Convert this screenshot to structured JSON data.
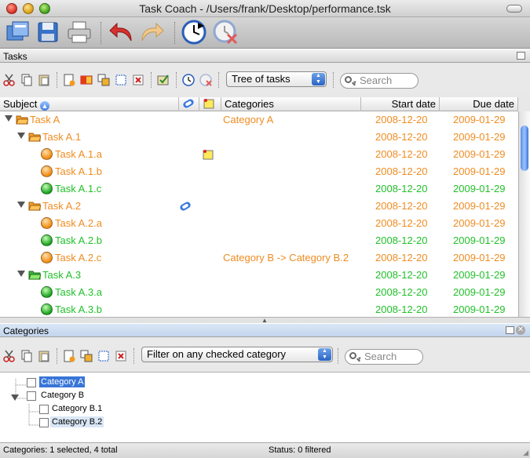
{
  "window": {
    "title": "Task Coach - /Users/frank/Desktop/performance.tsk"
  },
  "main_toolbar": {
    "icons": [
      "open-icon",
      "save-icon",
      "print-icon",
      "undo-icon",
      "redo-icon",
      "start-tracking-icon",
      "stop-tracking-icon"
    ]
  },
  "tasks_panel": {
    "title": "Tasks",
    "view_choice": "Tree of tasks",
    "search_placeholder": "Search",
    "columns": {
      "subject": "Subject",
      "categories": "Categories",
      "start_date": "Start date",
      "due_date": "Due date"
    },
    "rows": [
      {
        "subject": "Task A",
        "categories": "Category A",
        "start": "2008-12-20",
        "due": "2009-01-29",
        "color": "#ef8c22"
      },
      {
        "subject": "Task A.1",
        "categories": "",
        "start": "2008-12-20",
        "due": "2009-01-29",
        "color": "#ef8c22"
      },
      {
        "subject": "Task A.1.a",
        "categories": "",
        "start": "2008-12-20",
        "due": "2009-01-29",
        "color": "#ef8c22"
      },
      {
        "subject": "Task A.1.b",
        "categories": "",
        "start": "2008-12-20",
        "due": "2009-01-29",
        "color": "#ef8c22"
      },
      {
        "subject": "Task A.1.c",
        "categories": "",
        "start": "2008-12-20",
        "due": "2009-01-29",
        "color": "#22c02a"
      },
      {
        "subject": "Task A.2",
        "categories": "",
        "start": "2008-12-20",
        "due": "2009-01-29",
        "color": "#ef8c22"
      },
      {
        "subject": "Task A.2.a",
        "categories": "",
        "start": "2008-12-20",
        "due": "2009-01-29",
        "color": "#ef8c22"
      },
      {
        "subject": "Task A.2.b",
        "categories": "",
        "start": "2008-12-20",
        "due": "2009-01-29",
        "color": "#22c02a"
      },
      {
        "subject": "Task A.2.c",
        "categories": "Category B -> Category B.2",
        "start": "2008-12-20",
        "due": "2009-01-29",
        "color": "#ef8c22"
      },
      {
        "subject": "Task A.3",
        "categories": "",
        "start": "2008-12-20",
        "due": "2009-01-29",
        "color": "#22c02a"
      },
      {
        "subject": "Task A.3.a",
        "categories": "",
        "start": "2008-12-20",
        "due": "2009-01-29",
        "color": "#22c02a"
      },
      {
        "subject": "Task A.3.b",
        "categories": "",
        "start": "2008-12-20",
        "due": "2009-01-29",
        "color": "#22c02a"
      }
    ]
  },
  "categories_panel": {
    "title": "Categories",
    "filter_choice": "Filter on any checked category",
    "search_placeholder": "Search",
    "items": [
      {
        "label": "Category A",
        "checked": false,
        "selected": true
      },
      {
        "label": "Category B",
        "checked": false,
        "selected": false
      },
      {
        "label": "Category B.1",
        "checked": false,
        "selected": false
      },
      {
        "label": "Category B.2",
        "checked": false,
        "selected": false
      }
    ]
  },
  "status": {
    "left": "Categories: 1 selected, 4 total",
    "right": "Status: 0 filtered"
  }
}
